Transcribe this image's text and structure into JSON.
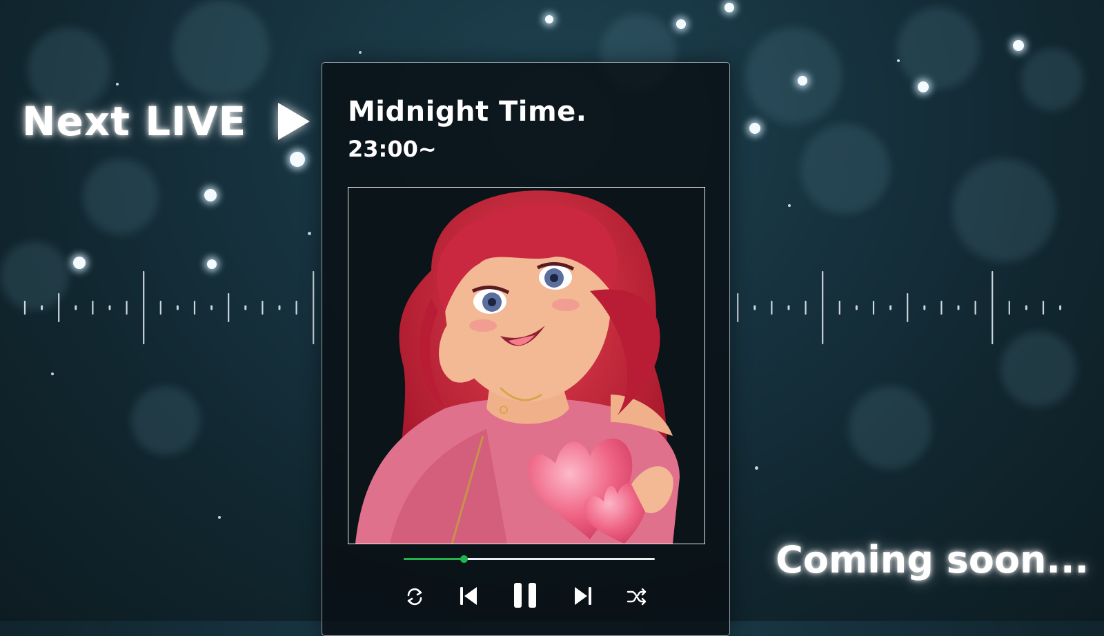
{
  "promo": {
    "headline": "Next LIVE",
    "headline_icon": "play-arrow-icon",
    "footer": "Coming soon..."
  },
  "player": {
    "title": "Midnight Time.",
    "time": "23:00~",
    "cover_icon": "anime-girl-illustration",
    "progress": 0.24,
    "colors": {
      "accent": "#22b34d",
      "track": "#e9eef2",
      "text": "#ffffff"
    },
    "controls": [
      {
        "name": "repeat",
        "icon": "repeat-icon"
      },
      {
        "name": "previous",
        "icon": "skip-previous-icon"
      },
      {
        "name": "pause",
        "icon": "pause-icon"
      },
      {
        "name": "next",
        "icon": "skip-next-icon"
      },
      {
        "name": "shuffle",
        "icon": "shuffle-icon"
      }
    ]
  }
}
